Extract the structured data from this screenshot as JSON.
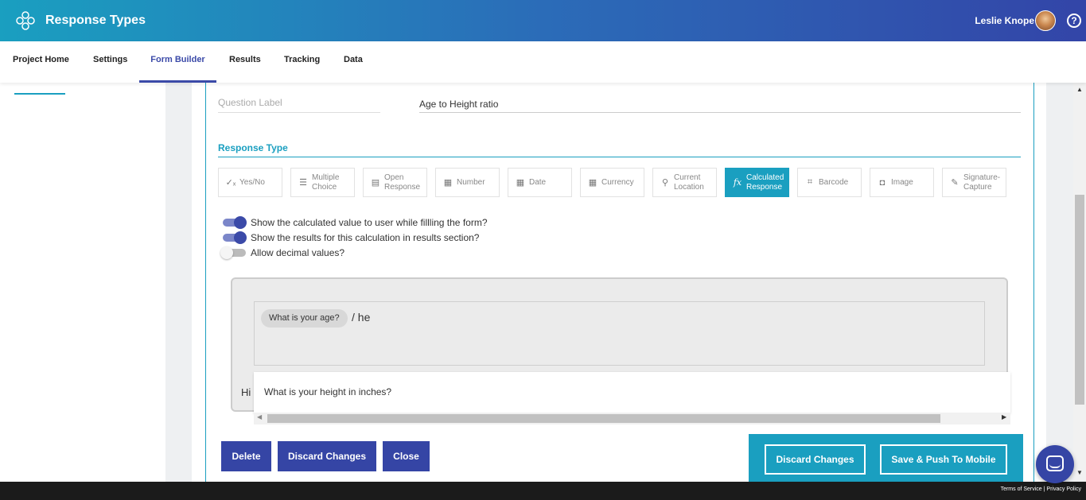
{
  "header": {
    "app_title": "Response Types",
    "user_name": "Leslie Knope",
    "help_symbol": "?"
  },
  "nav": {
    "tabs": [
      {
        "label": "Project Home"
      },
      {
        "label": "Settings"
      },
      {
        "label": "Form Builder",
        "active": true
      },
      {
        "label": "Results"
      },
      {
        "label": "Tracking"
      },
      {
        "label": "Data"
      }
    ]
  },
  "question": {
    "label_placeholder": "Question Label",
    "label_value": "Age to Height ratio"
  },
  "response_type": {
    "heading": "Response Type",
    "types": [
      {
        "label": "Yes/No",
        "icon": "yes-no-icon",
        "glyph": "✓ₓ"
      },
      {
        "label": "Multiple Choice",
        "icon": "list-icon",
        "glyph": "☰"
      },
      {
        "label": "Open Response",
        "icon": "text-box-icon",
        "glyph": "▤"
      },
      {
        "label": "Number",
        "icon": "calculator-icon",
        "glyph": "▦"
      },
      {
        "label": "Date",
        "icon": "calendar-icon",
        "glyph": "▦"
      },
      {
        "label": "Currency",
        "icon": "currency-icon",
        "glyph": "▦"
      },
      {
        "label": "Current Location",
        "icon": "location-pin-icon",
        "glyph": "⚲"
      },
      {
        "label": "Calculated Response",
        "icon": "function-icon",
        "glyph": "fx",
        "active": true
      },
      {
        "label": "Barcode",
        "icon": "barcode-icon",
        "glyph": "⌗"
      },
      {
        "label": "Image",
        "icon": "camera-icon",
        "glyph": "◘"
      },
      {
        "label": "Signature-Capture",
        "icon": "pen-icon",
        "glyph": "✎"
      }
    ]
  },
  "options": {
    "show_value": {
      "label": "Show the calculated value to user while fillling the form?",
      "on": true
    },
    "show_results": {
      "label": "Show the results for this calculation in results section?",
      "on": true
    },
    "allow_decimal": {
      "label": "Allow decimal values?",
      "on": false
    }
  },
  "formula": {
    "chip": "What is your age?",
    "text": "/ he",
    "hint_partial": "Hi",
    "suggestion": "What is your height in inches?"
  },
  "actions": {
    "delete": "Delete",
    "discard": "Discard Changes",
    "close": "Close",
    "footer_discard": "Discard Changes",
    "save_push": "Save & Push To Mobile"
  },
  "footer": {
    "terms": "Terms of Service",
    "privacy": "Privacy Policy"
  },
  "colors": {
    "accent": "#1a9fc0",
    "primary": "#3545a5"
  }
}
